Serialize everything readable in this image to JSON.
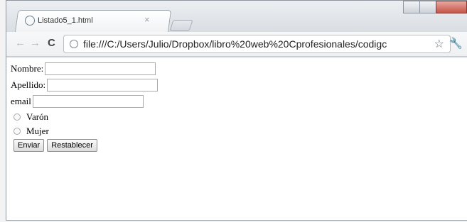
{
  "browser": {
    "tab": {
      "title": "Listado5_1.html",
      "close_glyph": "×"
    },
    "toolbar": {
      "back_glyph": "←",
      "forward_glyph": "→",
      "reload_glyph": "C",
      "url": "file:///C:/Users/Julio/Dropbox/libro%20web%20Cprofesionales/codigc",
      "star_glyph": "☆",
      "wrench_glyph": "🔧"
    }
  },
  "form": {
    "nombre_label": "Nombre:",
    "nombre_value": "",
    "apellido_label": "Apellido:",
    "apellido_value": "",
    "email_label": "email",
    "email_value": "",
    "radio_varon_label": "Varón",
    "radio_mujer_label": "Mujer",
    "submit_label": "Enviar",
    "reset_label": "Restablecer"
  }
}
